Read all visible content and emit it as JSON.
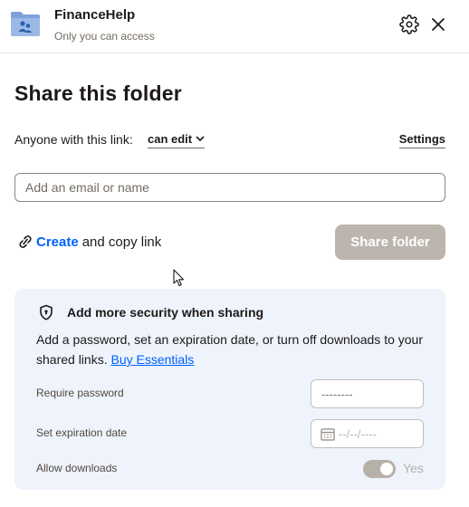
{
  "header": {
    "folder_name": "FinanceHelp",
    "access_text": "Only you can access",
    "icons": [
      "shared-folder-icon",
      "gear-icon",
      "close-icon"
    ]
  },
  "title": "Share this folder",
  "link_settings": {
    "label": "Anyone with this link:",
    "permission": "can edit",
    "settings_label": "Settings"
  },
  "email": {
    "placeholder": "Add an email or name",
    "value": ""
  },
  "actions": {
    "create_word": "Create",
    "copy_text": "and copy link",
    "share_button": "Share folder",
    "share_enabled": false
  },
  "security": {
    "heading": "Add more security when sharing",
    "description": "Add a password, set an expiration date, or turn off downloads to your shared links.",
    "buy_link": "Buy Essentials",
    "password_label": "Require password",
    "password_placeholder": "--------",
    "expiration_label": "Set expiration date",
    "expiration_placeholder": "--/--/----",
    "downloads_label": "Allow downloads",
    "downloads_state": "Yes",
    "downloads_enabled": true
  },
  "colors": {
    "accent": "#0061fe",
    "card_bg": "#eef3fc",
    "disabled_button": "#bbb5ae",
    "folder_icon": "#7ea2dd"
  }
}
